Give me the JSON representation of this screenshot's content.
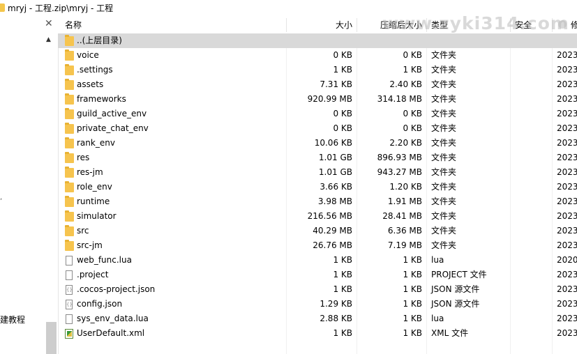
{
  "window": {
    "title": "mryj - 工程.zip\\mryj - 工程",
    "watermark": "www.zyki314.com"
  },
  "left_pane": {
    "text": "建教程",
    "tick": ","
  },
  "columns": {
    "name": "名称",
    "size": "大小",
    "compressed": "压缩后大小",
    "type": "类型",
    "security": "安全",
    "modified": "修"
  },
  "rows": [
    {
      "icon": "folder",
      "name": "..(上层目录)",
      "size": "",
      "compressed": "",
      "type": "",
      "date": "",
      "selected": true
    },
    {
      "icon": "folder",
      "name": "voice",
      "size": "0 KB",
      "compressed": "0 KB",
      "type": "文件夹",
      "date": "2023"
    },
    {
      "icon": "folder",
      "name": ".settings",
      "size": "1 KB",
      "compressed": "1 KB",
      "type": "文件夹",
      "date": "2023"
    },
    {
      "icon": "folder",
      "name": "assets",
      "size": "7.31 KB",
      "compressed": "2.40 KB",
      "type": "文件夹",
      "date": "2023"
    },
    {
      "icon": "folder",
      "name": "frameworks",
      "size": "920.99 MB",
      "compressed": "314.18 MB",
      "type": "文件夹",
      "date": "2023"
    },
    {
      "icon": "folder",
      "name": "guild_active_env",
      "size": "0 KB",
      "compressed": "0 KB",
      "type": "文件夹",
      "date": "2023"
    },
    {
      "icon": "folder",
      "name": "private_chat_env",
      "size": "0 KB",
      "compressed": "0 KB",
      "type": "文件夹",
      "date": "2023"
    },
    {
      "icon": "folder",
      "name": "rank_env",
      "size": "10.06 KB",
      "compressed": "2.20 KB",
      "type": "文件夹",
      "date": "2023"
    },
    {
      "icon": "folder",
      "name": "res",
      "size": "1.01 GB",
      "compressed": "896.93 MB",
      "type": "文件夹",
      "date": "2023"
    },
    {
      "icon": "folder",
      "name": "res-jm",
      "size": "1.01 GB",
      "compressed": "943.27 MB",
      "type": "文件夹",
      "date": "2023"
    },
    {
      "icon": "folder",
      "name": "role_env",
      "size": "3.66 KB",
      "compressed": "1.20 KB",
      "type": "文件夹",
      "date": "2023"
    },
    {
      "icon": "folder",
      "name": "runtime",
      "size": "3.98 MB",
      "compressed": "1.91 MB",
      "type": "文件夹",
      "date": "2023"
    },
    {
      "icon": "folder",
      "name": "simulator",
      "size": "216.56 MB",
      "compressed": "28.41 MB",
      "type": "文件夹",
      "date": "2023"
    },
    {
      "icon": "folder",
      "name": "src",
      "size": "40.29 MB",
      "compressed": "6.36 MB",
      "type": "文件夹",
      "date": "2023"
    },
    {
      "icon": "folder",
      "name": "src-jm",
      "size": "26.76 MB",
      "compressed": "7.19 MB",
      "type": "文件夹",
      "date": "2023"
    },
    {
      "icon": "file",
      "name": "web_func.lua",
      "size": "1 KB",
      "compressed": "1 KB",
      "type": "lua",
      "date": "2020"
    },
    {
      "icon": "file",
      "name": ".project",
      "size": "1 KB",
      "compressed": "1 KB",
      "type": "PROJECT 文件",
      "date": "2023"
    },
    {
      "icon": "json",
      "name": ".cocos-project.json",
      "size": "1 KB",
      "compressed": "1 KB",
      "type": "JSON 源文件",
      "date": "2023"
    },
    {
      "icon": "json",
      "name": "config.json",
      "size": "1.29 KB",
      "compressed": "1 KB",
      "type": "JSON 源文件",
      "date": "2023"
    },
    {
      "icon": "file",
      "name": "sys_env_data.lua",
      "size": "2.88 KB",
      "compressed": "1 KB",
      "type": "lua",
      "date": "2023"
    },
    {
      "icon": "xml",
      "name": "UserDefault.xml",
      "size": "1 KB",
      "compressed": "1 KB",
      "type": "XML 文件",
      "date": "2023"
    }
  ]
}
